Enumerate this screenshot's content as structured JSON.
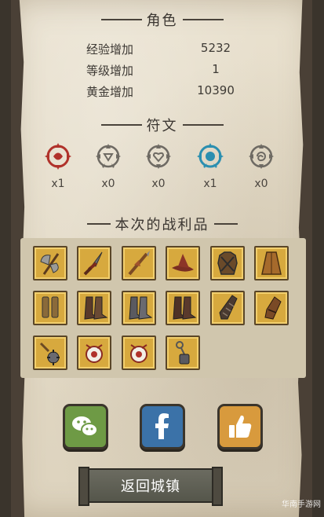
{
  "sections": {
    "character_title": "角色",
    "runes_title": "符文",
    "loot_title": "本次的战利品"
  },
  "stats": [
    {
      "label": "经验增加",
      "value": "5232"
    },
    {
      "label": "等级增加",
      "value": "1"
    },
    {
      "label": "黄金增加",
      "value": "10390"
    }
  ],
  "runes": [
    {
      "name": "red-rune-icon",
      "color": "#b0322b",
      "count": "x1"
    },
    {
      "name": "gray-rune-icon",
      "color": "#6e6a63",
      "count": "x0"
    },
    {
      "name": "heart-rune-icon",
      "color": "#6e6a63",
      "count": "x0"
    },
    {
      "name": "blue-rune-icon",
      "color": "#2b8fb0",
      "count": "x1"
    },
    {
      "name": "swirl-rune-icon",
      "color": "#6e6a63",
      "count": "x0"
    }
  ],
  "loot": [
    "battle-axe-icon",
    "dagger-icon",
    "spear-icon",
    "wizard-hat-icon",
    "chest-armor-icon",
    "cloak-icon",
    "leg-greaves-icon",
    "leather-boots-icon",
    "iron-boots-icon",
    "brown-boots-icon",
    "gauntlet-icon",
    "glove-icon",
    "flail-icon",
    "eye-orb-icon",
    "eye-orb-icon",
    "chain-mace-icon"
  ],
  "share": [
    {
      "name": "wechat-share-icon",
      "bg": "#6e9a45"
    },
    {
      "name": "facebook-share-icon",
      "bg": "#3b72a8"
    },
    {
      "name": "like-share-icon",
      "bg": "#d89a3d"
    }
  ],
  "return_button": "返回城镇",
  "watermark": "华南手游网"
}
